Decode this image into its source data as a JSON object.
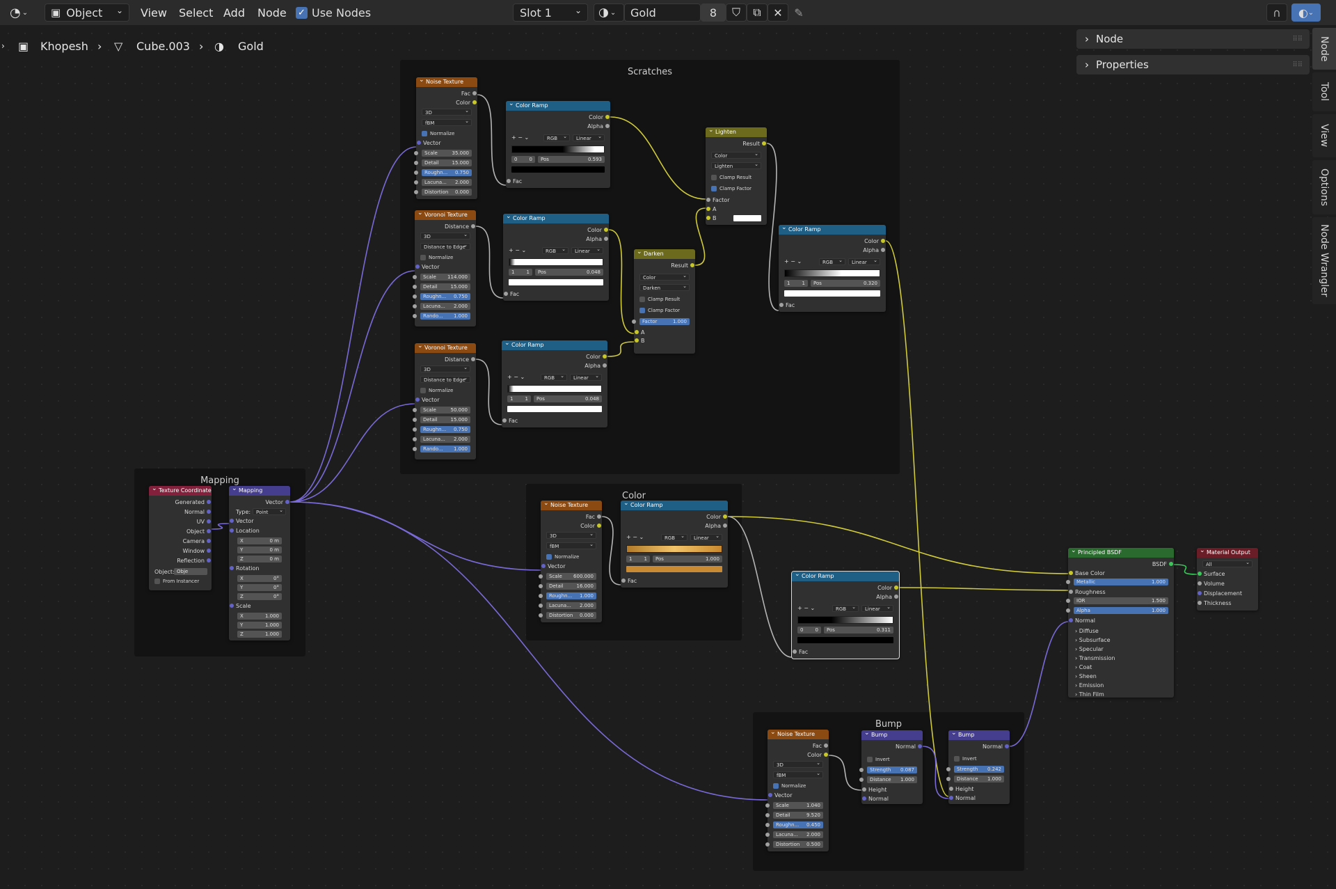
{
  "header": {
    "mode": "Object",
    "menus": [
      "View",
      "Select",
      "Add",
      "Node"
    ],
    "use_nodes": "Use Nodes",
    "slot": "Slot 1",
    "material": "Gold",
    "users": "8"
  },
  "breadcrumb": [
    "Khopesh",
    "Cube.003",
    "Gold"
  ],
  "sidebar": {
    "panels": [
      "Node",
      "Properties"
    ],
    "tabs": [
      "Node",
      "Tool",
      "View",
      "Options",
      "Node Wrangler"
    ]
  },
  "frames": {
    "scratches": "Scratches",
    "mapping": "Mapping",
    "color": "Color",
    "bump": "Bump"
  },
  "labels": {
    "fac": "Fac",
    "color": "Color",
    "alpha": "Alpha",
    "vector": "Vector",
    "distance": "Distance",
    "result": "Result",
    "factor": "Factor",
    "a": "A",
    "b": "B",
    "normal": "Normal",
    "height": "Height",
    "normalize": "Normalize",
    "clamp_result": "Clamp Result",
    "clamp_factor": "Clamp Factor",
    "invert": "Invert",
    "pos": "Pos",
    "rgb": "RGB",
    "linear": "Linear",
    "threed": "3D",
    "fbm": "fBM",
    "dist_edge": "Distance to Edge",
    "scale": "Scale",
    "detail": "Detail",
    "rough": "Roughn...",
    "rough2": "Rough...",
    "lacuna": "Lacuna...",
    "distortion": "Distortion",
    "rando": "Rando...",
    "rtools": "+  −  ⌄"
  },
  "nodes": {
    "noise1": {
      "title": "Noise Texture",
      "scale": "35.000",
      "detail": "15.000",
      "rough": "0.750",
      "lac": "2.000",
      "dist": "0.000"
    },
    "ramp1": {
      "title": "Color Ramp",
      "idx": "0",
      "pos": "0.593"
    },
    "vor1": {
      "title": "Voronoi Texture",
      "scale": "114.000",
      "detail": "15.000",
      "rough": "0.750",
      "lac": "2.000",
      "rand": "1.000"
    },
    "ramp2": {
      "title": "Color Ramp",
      "idx": "1",
      "pos": "0.048"
    },
    "vor2": {
      "title": "Voronoi Texture",
      "scale": "50.000",
      "detail": "15.000",
      "rough": "0.750",
      "lac": "2.000",
      "rand": "1.000"
    },
    "ramp3": {
      "title": "Color Ramp",
      "idx": "1",
      "pos": "0.048"
    },
    "darken": {
      "title": "Darken",
      "dtype": "Color",
      "blend": "Darken",
      "factor": "1.000"
    },
    "lighten": {
      "title": "Lighten",
      "dtype": "Color",
      "blend": "Lighten"
    },
    "ramp4": {
      "title": "Color Ramp",
      "idx": "1",
      "pos": "0.320"
    },
    "texcoord": {
      "title": "Texture Coordinate",
      "outs": [
        "Generated",
        "Normal",
        "UV",
        "Object",
        "Camera",
        "Window",
        "Reflection"
      ],
      "object": "Object:",
      "obj_field": "Obje",
      "from_inst": "From Instancer"
    },
    "mapping": {
      "title": "Mapping",
      "type_l": "Type:",
      "type": "Point",
      "location": "Location",
      "rotation": "Rotation",
      "scale": "Scale",
      "x": "X",
      "y": "Y",
      "z": "Z",
      "loc": [
        "0 m",
        "0 m",
        "0 m"
      ],
      "rot": [
        "0°",
        "0°",
        "0°"
      ],
      "scl": [
        "1.000",
        "1.000",
        "1.000"
      ]
    },
    "noise2": {
      "title": "Noise Texture",
      "scale": "600.000",
      "detail": "16.000",
      "rough": "1.000",
      "lac": "2.000",
      "dist": "0.000"
    },
    "ramp5": {
      "title": "Color Ramp",
      "idx": "1",
      "pos": "1.000"
    },
    "ramp6": {
      "title": "Color Ramp",
      "idx": "0",
      "pos": "0.311"
    },
    "bsdf": {
      "title": "Principled BSDF",
      "out": "BSDF",
      "base": "Base Color",
      "metallic": "Metallic",
      "metallic_v": "1.000",
      "roughness": "Roughness",
      "ior": "IOR",
      "ior_v": "1.500",
      "alpha_v": "1.000",
      "normal": "Normal",
      "subs": [
        "Diffuse",
        "Subsurface",
        "Specular",
        "Transmission",
        "Coat",
        "Sheen",
        "Emission",
        "Thin Film"
      ]
    },
    "output": {
      "title": "Material Output",
      "target": "All",
      "ins": [
        "Surface",
        "Volume",
        "Displacement",
        "Thickness"
      ]
    },
    "noise3": {
      "title": "Noise Texture",
      "scale": "1.040",
      "detail": "9.520",
      "rough": "0.450",
      "lac": "2.000",
      "dist": "0.500"
    },
    "bump1": {
      "title": "Bump",
      "strength": "Strength",
      "strength_v": "0.087",
      "distance": "Distance",
      "distance_v": "1.000"
    },
    "bump2": {
      "title": "Bump",
      "strength_v": "0.242",
      "distance_v": "1.000"
    }
  },
  "colors": {
    "texture": "#8a4a12",
    "converter": "#1f5f86",
    "color": "#6c6a1d",
    "vector": "#453e8e",
    "input": "#83203c",
    "shader": "#2b6a2e",
    "output": "#6b1d27",
    "gold": "#d9a24a"
  }
}
